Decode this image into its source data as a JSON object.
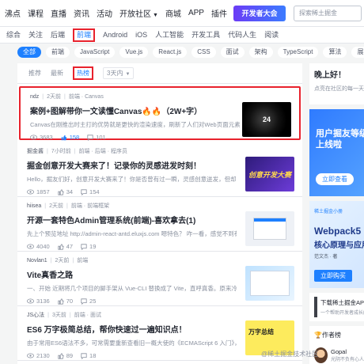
{
  "nav": {
    "logo": "沸点",
    "items": [
      "课程",
      "直播",
      "资讯",
      "活动",
      "开放社区",
      "商城",
      "APP",
      "插件"
    ],
    "open_community_has_caret": true,
    "app_badge": "1",
    "promo": "开发者大会",
    "search_placeholder": "探索稀土掘金"
  },
  "categories": [
    "综合",
    "关注",
    "后端",
    "前端",
    "Android",
    "iOS",
    "人工智能",
    "开发工具",
    "代码人生",
    "阅读"
  ],
  "active_category": "前端",
  "tags": [
    "全部",
    "前端",
    "JavaScript",
    "Vue.js",
    "React.js",
    "CSS",
    "面试",
    "架构",
    "TypeScript",
    "算法",
    "展开"
  ],
  "active_tag": "全部",
  "sorts": {
    "recommend": "推荐",
    "latest": "最新",
    "hot": "热榜",
    "period": "3天内"
  },
  "articles": [
    {
      "author": "ndz",
      "time": "2天前",
      "tags": "前端 · Canvas",
      "title": "案例+图解带你一文读懂Canvas🔥🔥（2W+字）",
      "abstract": "Canvas在刚推出时主打的优势就是更快的渲染速度，刷新了人们对Web页面元素绘制速...",
      "views": "3683",
      "likes": "158",
      "comments": "101",
      "thumb_text": "24"
    },
    {
      "author": "掘金酱",
      "time": "7小时前",
      "tags": "前端 · 后端 · 程序员",
      "title": "掘金创意开发大赛来了！记录你的灵感进发时刻！",
      "abstract": "Hello，掘友们好，创意开发大赛来了！你是否曾有过一瞬，灵感创意迸发，但却没有及...",
      "views": "1857",
      "likes": "34",
      "comments": "154",
      "thumb_text": "创意开发大赛"
    },
    {
      "author": "hiisea",
      "time": "2天前",
      "tags": "前端 · 前端框架",
      "title": "开源一套特色Admin管理系统(前端)-喜欢拿去(1)",
      "abstract": "先上个预览地址 http://admin-react-antd.eluxjs.com 嗯特色？ 咋一看，感觉不到有啥特色...",
      "views": "4040",
      "likes": "47",
      "comments": "19",
      "thumb_text": ""
    },
    {
      "author": "Novlan1",
      "time": "2天前",
      "tags": "前端",
      "title": "Vite真香之路",
      "abstract": "一、开始 近期将几个项目的脚手架从 Vue-CLI 替换成了 Vite，直呼真香。原来冷启动2分多钟，现在只要几秒。...",
      "views": "3136",
      "likes": "70",
      "comments": "25",
      "thumb_text": ""
    },
    {
      "author": "JS心法",
      "time": "3天前",
      "tags": "前端 · 面试",
      "title": "ES6 万字极简总结，帮你快速过一遍知识点！",
      "abstract": "由于常用ES6语法不多，可常需要重新查看旧一概大使的《ECMAScript 6 入门》，这次...",
      "views": "2130",
      "likes": "89",
      "comments": "18",
      "thumb_text": "万字总结"
    }
  ],
  "sidebar": {
    "greeting": "晚上好！",
    "greeting_sub": "点亮在社区的每一天",
    "ad1_title": "用户掘友等级",
    "ad1_title2": "上线啦",
    "ad1_btn": "立即查看",
    "ad2_small": "稀土掘金小册",
    "ad2_title": "Webpack5",
    "ad2_title2": "核心原理与应用",
    "ad2_sub": "范文杰 · 著",
    "ad2_btn": "立即购买",
    "app_title": "下载稀土掘金APP",
    "app_sub": "一个帮助开发者成长的社区",
    "authors_title": "🏆作者榜",
    "author_name": "Gopal",
    "author_sub": "光阴不负有心人"
  },
  "watermark": "@稀土掘金技术社区"
}
